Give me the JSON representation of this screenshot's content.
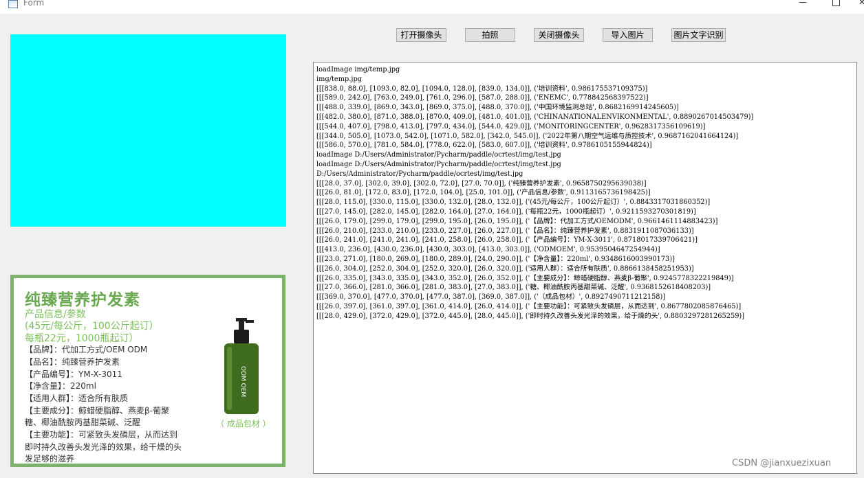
{
  "window": {
    "title": "Form",
    "min": "—",
    "close": "✕"
  },
  "toolbar": {
    "open_camera": "打开摄像头",
    "take_photo": "拍照",
    "close_camera": "关闭摄像头",
    "import_image": "导入图片",
    "ocr": "图片文字识别"
  },
  "camera": {
    "color": "#00ffff"
  },
  "product": {
    "title": "纯臻营养护发素",
    "subtitle": "产品信息/参数",
    "price1": "(45元/每公斤，100公斤起订）",
    "price2": "每瓶22元，1000瓶起订）",
    "lines": [
      "【品牌】：代加工方式/OEM ODM",
      "【品名】：纯臻营养护发素",
      "【产品编号】：YM-X-3011",
      "【净含量】：220ml",
      "【适用人群】：适合所有肤质",
      "【主要成分】：鲸蜡硬脂醇、燕麦β-葡聚",
      "糖、椰油酰胺丙基甜菜碱、泛醒",
      "【主要功能】：可紧致头发磷层，从而达到",
      "即时持久改善头发光泽的效果，给干燥的头",
      "发足够的滋养"
    ],
    "bottle_label": "ODM OEM",
    "caption": "（ 成品包材 ）",
    "border_color": "#7db26b"
  },
  "log": [
    "loadImage img/temp.jpg",
    "img/temp.jpg",
    "[[[838.0, 88.0], [1093.0, 82.0], [1094.0, 128.0], [839.0, 134.0]], ('培训资料', 0.986175537109375)]",
    "[[[589.0, 242.0], [763.0, 249.0], [761.0, 296.0], [587.0, 288.0]], ('ENEMC', 0.778842568397522)]",
    "[[[488.0, 339.0], [869.0, 343.0], [869.0, 375.0], [488.0, 370.0]], ('中国环境监测总站', 0.8682169914245605)]",
    "[[[482.0, 380.0], [871.0, 388.0], [870.0, 409.0], [481.0, 401.0]], ('CHINANATIONALENVIKONMENTAL', 0.8890267014503479)]",
    "[[[544.0, 407.0], [798.0, 413.0], [797.0, 434.0], [544.0, 429.0]], ('MONITORINGCENTER', 0.9628317356109619)]",
    "[[[344.0, 505.0], [1073.0, 542.0], [1071.0, 582.0], [342.0, 545.0]], ('2022年第八期空气运维与质控技术', 0.9687162041664124)]",
    "[[[586.0, 570.0], [781.0, 584.0], [778.0, 622.0], [583.0, 607.0]], ('培训资料', 0.9786105155944824)]",
    "loadImage D:/Users/Administrator/Pycharm/paddle/ocrtest/img/test.jpg",
    "loadImage D:/Users/Administrator/Pycharm/paddle/ocrtest/img/test.jpg",
    "D:/Users/Administrator/Pycharm/paddle/ocrtest/img/test.jpg",
    "[[[28.0, 37.0], [302.0, 39.0], [302.0, 72.0], [27.0, 70.0]], ('纯臻营养护发素', 0.9658750295639038)]",
    "[[[26.0, 81.0], [172.0, 83.0], [172.0, 104.0], [25.0, 101.0]], ('产品信息/参数', 0.9113165736198425)]",
    "[[[28.0, 115.0], [330.0, 115.0], [330.0, 132.0], [28.0, 132.0]], ('(45元/每公斤，100公斤起订）', 0.8843317031860352)]",
    "[[[27.0, 145.0], [282.0, 145.0], [282.0, 164.0], [27.0, 164.0]], ('每瓶22元，1000瓶起订）', 0.9211593270301819)]",
    "[[[26.0, 179.0], [299.0, 179.0], [299.0, 195.0], [26.0, 195.0]], ('【品牌】：代加工方式/OEMODM', 0.9661461114883423)]",
    "[[[26.0, 210.0], [233.0, 210.0], [233.0, 227.0], [26.0, 227.0]], ('【品名】：纯臻营养护发素', 0.8831911087036133)]",
    "[[[26.0, 241.0], [241.0, 241.0], [241.0, 258.0], [26.0, 258.0]], ('【产品编号】：YM-X-3011', 0.8718017339706421)]",
    "[[[413.0, 236.0], [430.0, 236.0], [430.0, 303.0], [413.0, 303.0]], ('ODMOEM', 0.9539504647254944)]",
    "[[[23.0, 271.0], [180.0, 269.0], [180.0, 289.0], [24.0, 290.0]], ('【净含量】：220ml', 0.9348616003990173)]",
    "[[[26.0, 304.0], [252.0, 304.0], [252.0, 320.0], [26.0, 320.0]], ('适用人群）：适合所有肤质', 0.8866138458251953)]",
    "[[[26.0, 335.0], [343.0, 335.0], [343.0, 352.0], [26.0, 352.0]], ('【主要成分】：鲸蜡硬脂醇、燕麦β-葡聚', 0.9245778322219849)]",
    "[[[27.0, 366.0], [281.0, 366.0], [281.0, 383.0], [27.0, 383.0]], ('糖、椰油酰胺丙基甜菜碱、泛醒', 0.9368152618408203)]",
    "[[[369.0, 370.0], [477.0, 370.0], [477.0, 387.0], [369.0, 387.0]], ('（成品包材）', 0.8927490711212158)]",
    "[[[26.0, 397.0], [361.0, 397.0], [361.0, 414.0], [26.0, 414.0]], ('【主要功能】：可紧致头发磷层，从而达到', 0.8677802085876465)]",
    "[[[28.0, 429.0], [372.0, 429.0], [372.0, 445.0], [28.0, 445.0]], ('即时持久改善头发光泽的效果，给于燥的头', 0.8803297281265259)]",
    "[[[27.0, 459.0], [136.0, 459.0], [136.0, 479.0], [27.0, 479.0]], ('发足够的滋养', 0.9091537594795227)]"
  ],
  "watermark": "CSDN @jianxuezixuan"
}
